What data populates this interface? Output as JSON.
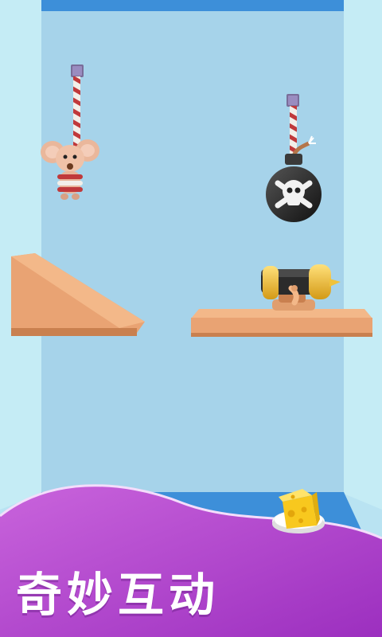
{
  "promo": {
    "caption": "奇妙互动"
  },
  "colors": {
    "background": "#a9d6ec",
    "side_wall": "#c5ecf5",
    "floor": "#3d8fd9",
    "wood": "#e9a373",
    "banner": "#b83fcf",
    "bomb": "#262626",
    "cannon_brass": "#f0c23a"
  },
  "icons": [
    "mouse",
    "rope",
    "pin",
    "bomb-skull",
    "cannon",
    "cheese",
    "wooden-ramp",
    "wooden-shelf"
  ]
}
